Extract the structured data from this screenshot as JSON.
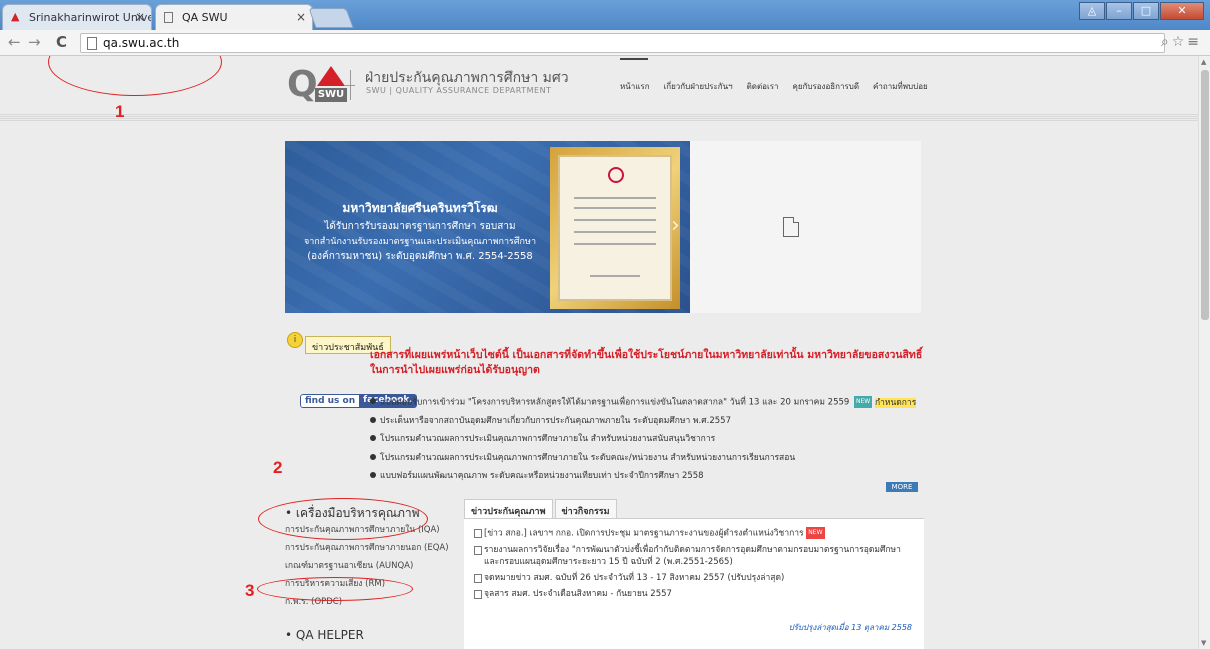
{
  "browser": {
    "tabs": [
      {
        "title": "Srinakharinwirot Universi...",
        "active": false
      },
      {
        "title": "QA SWU",
        "active": true
      }
    ],
    "url": "qa.swu.ac.th"
  },
  "site": {
    "logo_text": "QA",
    "logo_badge": "SWU",
    "title_th": "ฝ่ายประกันคุณภาพการศึกษา มศว",
    "title_en": "SWU | QUALITY ASSURANCE DEPARTMENT",
    "nav": [
      "หน้าแรก",
      "เกี่ยวกับฝ่ายประกันฯ",
      "ติดต่อเรา",
      "คุยกับรองอธิการบดี",
      "คำถามที่พบบ่อย"
    ]
  },
  "banner": {
    "lines": [
      "มหาวิทยาลัยศรีนครินทรวิโรฒ",
      "ได้รับการรับรองมาตรฐานการศึกษา รอบสาม",
      "จากสำนักงานรับรองมาตรฐานและประเมินคุณภาพการศึกษา",
      "(องค์การมหาชน) ระดับอุดมศึกษา พ.ศ. 2554-2558"
    ]
  },
  "pr": {
    "icon": "i",
    "tab_label": "ข่าวประชาสัมพันธ์",
    "notice": "เอกสารที่เผยแพร่หน้าเว็บไซต์นี้ เป็นเอกสารที่จัดทำขึ้นเพื่อใช้ประโยชน์ภายในมหาวิทยาลัยเท่านั้น มหาวิทยาลัยขอสงวนสิทธิ์ในการนำไปเผยแพร่ก่อนได้รับอนุญาต"
  },
  "facebook": {
    "part1": "find us on",
    "part2": "facebook."
  },
  "news": [
    {
      "text": "แบบตอบรับการเข้าร่วม \"โครงการบริหารหลักสูตรให้ได้มาตรฐานเพื่อการแข่งขันในตลาดสากล\" วันที่ 13 และ 20 มกราคม 2559",
      "tag": "NEW",
      "highlight": "กำหนดการ"
    },
    {
      "text": "ประเด็นหารือจากสถาบันอุดมศึกษาเกี่ยวกับการประกันคุณภาพภายใน ระดับอุดมศึกษา พ.ศ.2557"
    },
    {
      "text": "โปรแกรมคำนวณผลการประเมินคุณภาพการศึกษาภายใน สำหรับหน่วยงานสนับสนุนวิชาการ"
    },
    {
      "text": "โปรแกรมคำนวณผลการประเมินคุณภาพการศึกษาภายใน ระดับคณะ/หน่วยงาน สำหรับหน่วยงานการเรียนการสอน"
    },
    {
      "text": "แบบฟอร์มแผนพัฒนาคุณภาพ ระดับคณะหรือหน่วยงานเทียบเท่า ประจำปีการศึกษา 2558"
    }
  ],
  "more_label": "MORE",
  "sidebar": {
    "heading": "เครื่องมือบริหารคุณภาพ",
    "items": [
      "การประกันคุณภาพการศึกษาภายใน (IQA)",
      "การประกันคุณภาพการศึกษาภายนอก (EQA)",
      "เกณฑ์มาตรฐานอาเซียน (AUNQA)",
      "การบริหารความเสี่ยง (RM)",
      "ก.พ.ร. (OPDC)"
    ],
    "heading2": "QA HELPER"
  },
  "news_tabs": {
    "tabs": [
      "ข่าวประกันคุณภาพ",
      "ข่าวกิจกรรม"
    ],
    "items": [
      {
        "text": "[ข่าว สกอ.] เลขาฯ กกอ. เปิดการประชุม มาตรฐานภาระงานของผู้ดำรงตำแหน่งวิชาการ",
        "tag": "NEW"
      },
      {
        "text": "รายงานผลการวิจัยเรื่อง \"การพัฒนาตัวบ่งชี้เพื่อกำกับติดตามการจัดการอุดมศึกษาตามกรอบมาตรฐานการอุดมศึกษา และกรอบแผนอุดมศึกษาระยะยาว 15 ปี ฉบับที่ 2 (พ.ศ.2551-2565)"
      },
      {
        "text": "จดหมายข่าว สมศ. ฉบับที่ 26 ประจำวันที่ 13 - 17 สิงหาคม 2557 (ปรับปรุงล่าสุด)"
      },
      {
        "text": "จุลสาร สมศ. ประจำเดือนสิงหาคม - กันยายน 2557"
      }
    ],
    "updated": "ปรับปรุงล่าสุดเมื่อ 13 ตุลาคม 2558"
  },
  "annotations": {
    "n1": "1",
    "n2": "2",
    "n3": "3",
    "color": "#e02020"
  }
}
